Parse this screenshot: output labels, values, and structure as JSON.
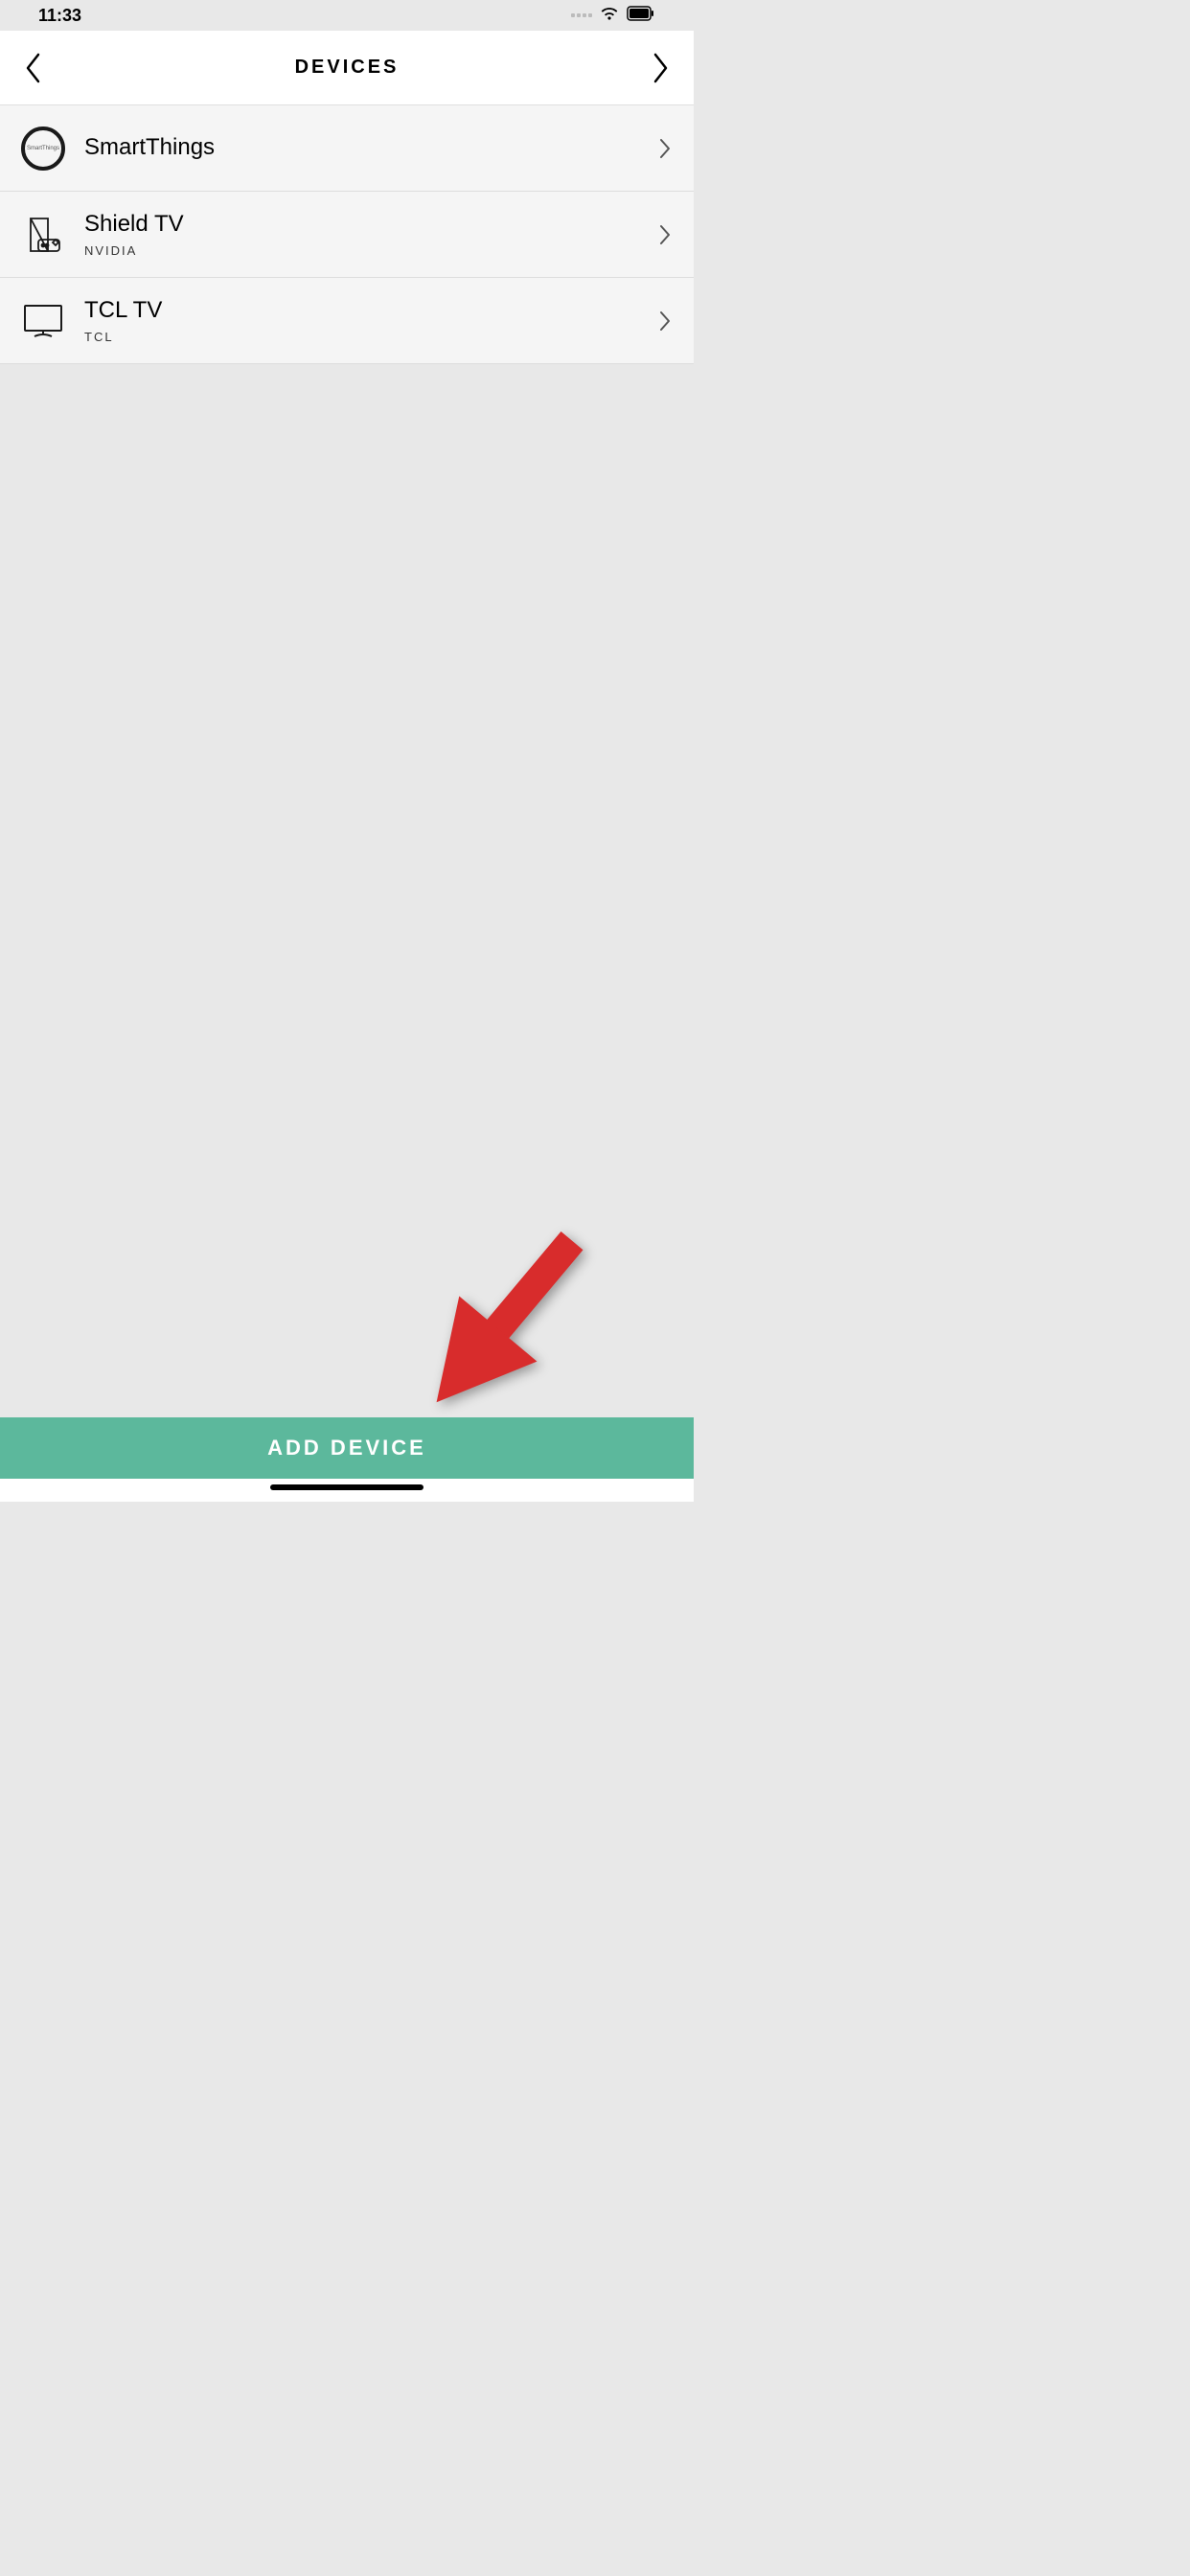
{
  "status": {
    "time": "11:33"
  },
  "header": {
    "title": "DEVICES"
  },
  "devices": [
    {
      "name": "SmartThings",
      "sub": "",
      "icon": "smartthings"
    },
    {
      "name": "Shield TV",
      "sub": "NVIDIA",
      "icon": "shield"
    },
    {
      "name": "TCL TV",
      "sub": "TCL",
      "icon": "tv"
    }
  ],
  "footer": {
    "add_device": "ADD DEVICE"
  },
  "smartthings_label": "SmartThings"
}
